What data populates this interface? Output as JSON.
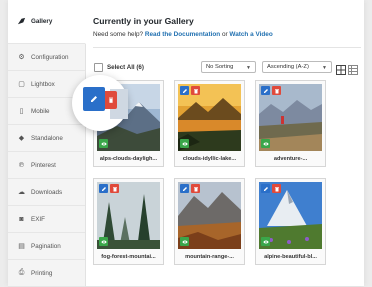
{
  "sidebar": {
    "items": [
      {
        "label": "Gallery",
        "icon": "envira-leaf-icon",
        "active": true
      },
      {
        "label": "Configuration",
        "icon": "gear-icon"
      },
      {
        "label": "Lightbox",
        "icon": "lightbox-icon"
      },
      {
        "label": "Mobile",
        "icon": "mobile-icon"
      },
      {
        "label": "Standalone",
        "icon": "standalone-icon"
      },
      {
        "label": "Pinterest",
        "icon": "pinterest-icon"
      },
      {
        "label": "Downloads",
        "icon": "cloud-download-icon"
      },
      {
        "label": "EXIF",
        "icon": "camera-icon"
      },
      {
        "label": "Pagination",
        "icon": "pagination-icon"
      },
      {
        "label": "Printing",
        "icon": "printer-icon"
      }
    ]
  },
  "header": {
    "title": "Currently in your Gallery",
    "help_prefix": "Need some help?",
    "docs_link": "Read the Documentation",
    "or_text": "or",
    "video_link": "Watch a Video"
  },
  "toolbar": {
    "select_all": "Select All (6)",
    "sort_value": "No Sorting",
    "order_value": "Ascending (A-Z)"
  },
  "images": [
    {
      "caption": "alps-clouds-dayligh..."
    },
    {
      "caption": "clouds-idyllic-lake..."
    },
    {
      "caption": "adventure-..."
    },
    {
      "caption": "fog-forest-mountai..."
    },
    {
      "caption": "mountain-range-..."
    },
    {
      "caption": "alpine-beautiful-bl..."
    }
  ],
  "colors": {
    "edit": "#2a6fc9",
    "delete": "#e04a3b",
    "visible": "#3aa64a",
    "link": "#2271b1"
  }
}
